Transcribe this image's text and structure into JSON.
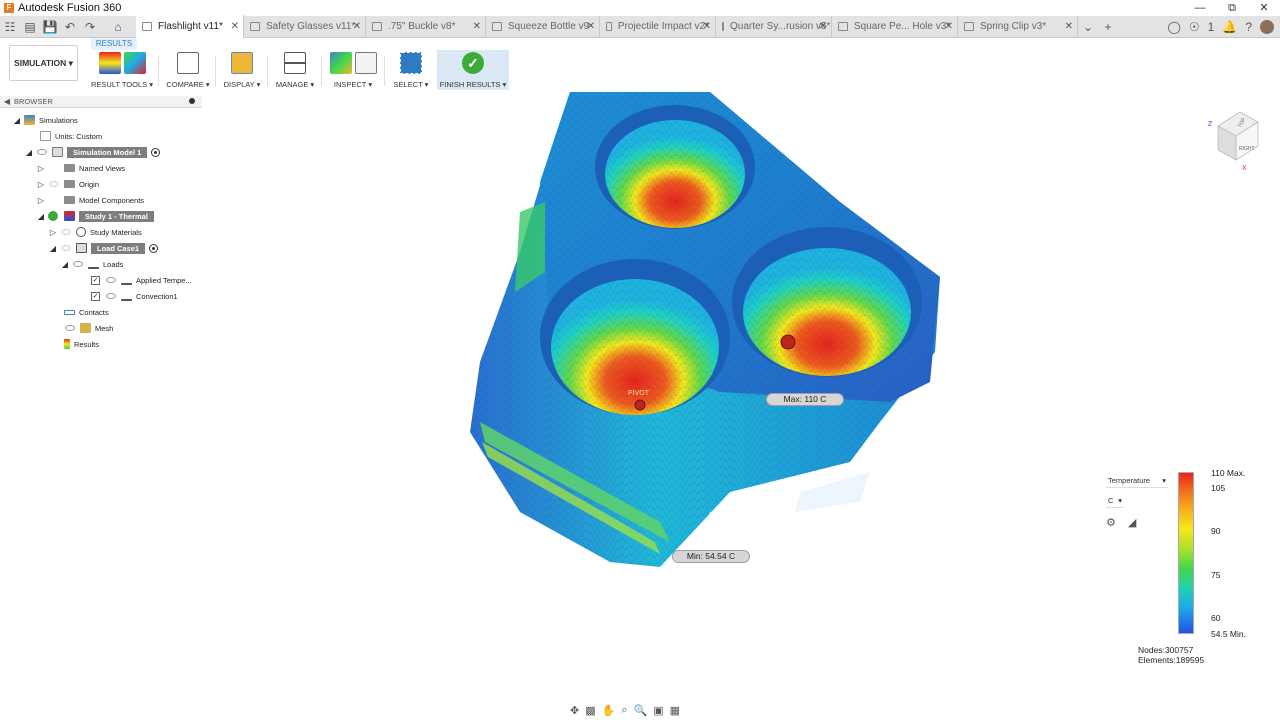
{
  "window": {
    "title": "Autodesk Fusion 360"
  },
  "tabs": [
    {
      "label": "Flashlight v11*",
      "active": true
    },
    {
      "label": "Safety Glasses v11*"
    },
    {
      "label": ".75\" Buckle v8*"
    },
    {
      "label": "Squeeze Bottle v9"
    },
    {
      "label": "Projectile Impact v2*"
    },
    {
      "label": "Quarter Sy...rusion v5*"
    },
    {
      "label": "Square Pe... Hole v3*"
    },
    {
      "label": "Spring Clip v3*"
    }
  ],
  "tabbar_right": {
    "notification_count": "1"
  },
  "toolbar": {
    "workspace": "SIMULATION",
    "active_tab": "RESULTS",
    "groups": {
      "result_tools": "RESULT TOOLS",
      "compare": "COMPARE",
      "display": "DISPLAY",
      "manage": "MANAGE",
      "inspect": "INSPECT",
      "select": "SELECT",
      "finish": "FINISH RESULTS"
    }
  },
  "browser": {
    "header": "BROWSER",
    "items": [
      {
        "label": "Simulations"
      },
      {
        "label": "Units: Custom"
      },
      {
        "label": "Simulation Model 1"
      },
      {
        "label": "Named Views"
      },
      {
        "label": "Origin"
      },
      {
        "label": "Model Components"
      },
      {
        "label": "Study 1 - Thermal"
      },
      {
        "label": "Study Materials"
      },
      {
        "label": "Load Case1"
      },
      {
        "label": "Loads"
      },
      {
        "label": "Applied Tempe..."
      },
      {
        "label": "Convection1"
      },
      {
        "label": "Contacts"
      },
      {
        "label": "Mesh"
      },
      {
        "label": "Results"
      }
    ]
  },
  "probes": {
    "max": "Max: 110 C",
    "min": "Min: 54.54 C",
    "pivot": "PIVOT"
  },
  "viewcube": {
    "top": "TOP",
    "right": "RIGHT",
    "z": "Z",
    "x": "X"
  },
  "legend": {
    "quantity": "Temperature",
    "unit": "C",
    "max_label": "110 Max.",
    "ticks": [
      "105",
      "90",
      "75",
      "60"
    ],
    "min_label": "54.5 Min.",
    "colors": [
      "#e8231e",
      "#f6a21d",
      "#f4e81b",
      "#40d84a",
      "#1fd1b4",
      "#1fa9e8",
      "#2253e4"
    ]
  },
  "stats": {
    "nodes_label": "Nodes:",
    "nodes_value": "300757",
    "elements_label": "Elements:",
    "elements_value": "189595"
  }
}
